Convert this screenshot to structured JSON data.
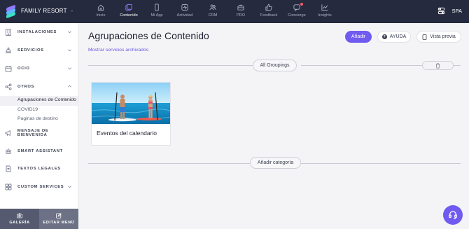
{
  "app": {
    "brand_name": "FAMILY RESORT",
    "language": "SPA"
  },
  "nav": [
    {
      "label": "Inicio",
      "icon": "home-icon",
      "active": false
    },
    {
      "label": "Contenido",
      "icon": "content-icon",
      "active": true
    },
    {
      "label": "Mi App",
      "icon": "phone-icon",
      "active": false
    },
    {
      "label": "Actividad",
      "icon": "activity-icon",
      "active": false
    },
    {
      "label": "CRM",
      "icon": "users-icon",
      "active": false
    },
    {
      "label": "PRO",
      "icon": "briefcase-icon",
      "active": false
    },
    {
      "label": "Feedback",
      "icon": "thumbs-up-icon",
      "active": false
    },
    {
      "label": "Concierge",
      "icon": "chat-icon",
      "active": false,
      "badge": true
    },
    {
      "label": "Insights",
      "icon": "chart-icon",
      "active": false
    }
  ],
  "sidebar": {
    "items": [
      {
        "label": "INSTALACIONES",
        "icon": "building-icon",
        "expandable": true
      },
      {
        "label": "SERVICIOS",
        "icon": "concierge-bell-icon",
        "expandable": true
      },
      {
        "label": "OCIO",
        "icon": "calendar-icon",
        "expandable": true
      },
      {
        "label": "OTROS",
        "icon": "share-icon",
        "expandable": true,
        "expanded": true
      },
      {
        "label": "MENSAJE DE BIENVENIDA",
        "icon": "megaphone-icon",
        "expandable": false
      },
      {
        "label": "SMART ASSISTANT",
        "icon": "robot-icon",
        "expandable": false
      },
      {
        "label": "TEXTOS LEGALES",
        "icon": "document-icon",
        "expandable": false
      },
      {
        "label": "CUSTOM SERVICES",
        "icon": "services-icon",
        "expandable": true
      }
    ],
    "sub_items": [
      "Agrupaciones de Contenido",
      "COVID19",
      "Paginas de destino"
    ],
    "bottom": {
      "gallery": "GALERÍA",
      "edit_menu": "EDITAR MENÚ"
    }
  },
  "main": {
    "title": "Agrupaciones de Contenido",
    "archived_link": "Mostrar servicios archivados",
    "buttons": {
      "add": "Añadir",
      "help": "AYUDA",
      "preview": "Vista previa"
    },
    "grouping_pill": "All Groupings",
    "card": {
      "title": "Eventos del calendario",
      "image": "paddle-board-photo"
    },
    "add_category": "Añadir categoría"
  },
  "colors": {
    "accent": "#6f5bf0",
    "topbar": "#262a3e",
    "link": "#6b57e6"
  }
}
